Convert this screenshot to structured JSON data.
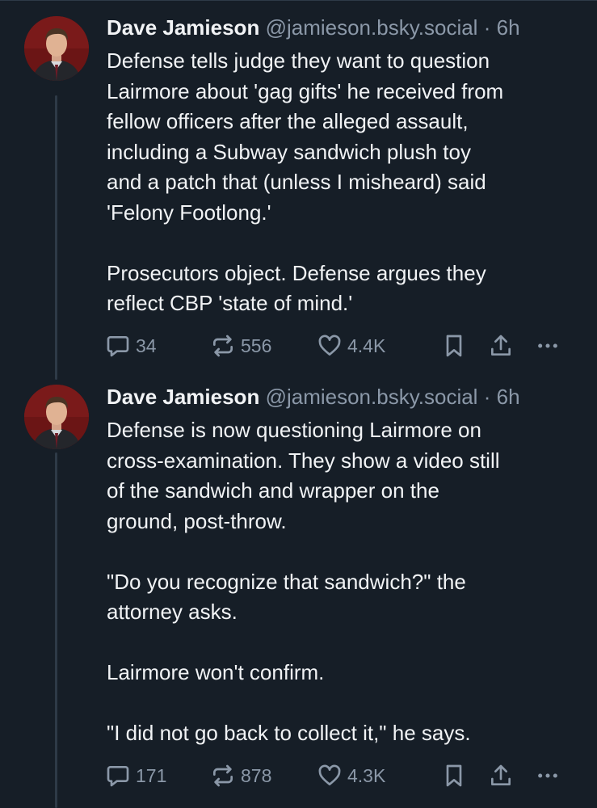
{
  "posts": [
    {
      "display_name": "Dave Jamieson",
      "handle": "@jamieson.bsky.social",
      "separator": "·",
      "time": "6h",
      "body_lines": [
        "Defense tells judge they want to question",
        "Lairmore about 'gag gifts' he received from",
        "fellow officers after the alleged assault,",
        "including a Subway sandwich plush toy",
        "and a patch that (unless I misheard) said",
        "'Felony Footlong.'",
        "",
        "Prosecutors object. Defense argues they",
        "reflect CBP 'state of mind.'"
      ],
      "replies": "34",
      "reposts": "556",
      "likes": "4.4K"
    },
    {
      "display_name": "Dave Jamieson",
      "handle": "@jamieson.bsky.social",
      "separator": "·",
      "time": "6h",
      "body_lines": [
        "Defense is now questioning Lairmore on",
        "cross-examination. They show a video still",
        "of the sandwich and wrapper on the",
        "ground, post-throw.",
        "",
        "\"Do you recognize that sandwich?\" the",
        "attorney asks.",
        "",
        "Lairmore won't confirm.",
        "",
        "\"I did not go back to collect it,\" he says."
      ],
      "replies": "171",
      "reposts": "878",
      "likes": "4.3K"
    }
  ],
  "icons": {
    "reply": "reply-icon",
    "repost": "repost-icon",
    "like": "like-icon",
    "bookmark": "bookmark-icon",
    "share": "share-icon",
    "more": "more-icon"
  },
  "colors": {
    "background": "#161e27",
    "text": "#f1f3f5",
    "muted": "#8b98a8",
    "thread_line": "#2e3a47"
  }
}
